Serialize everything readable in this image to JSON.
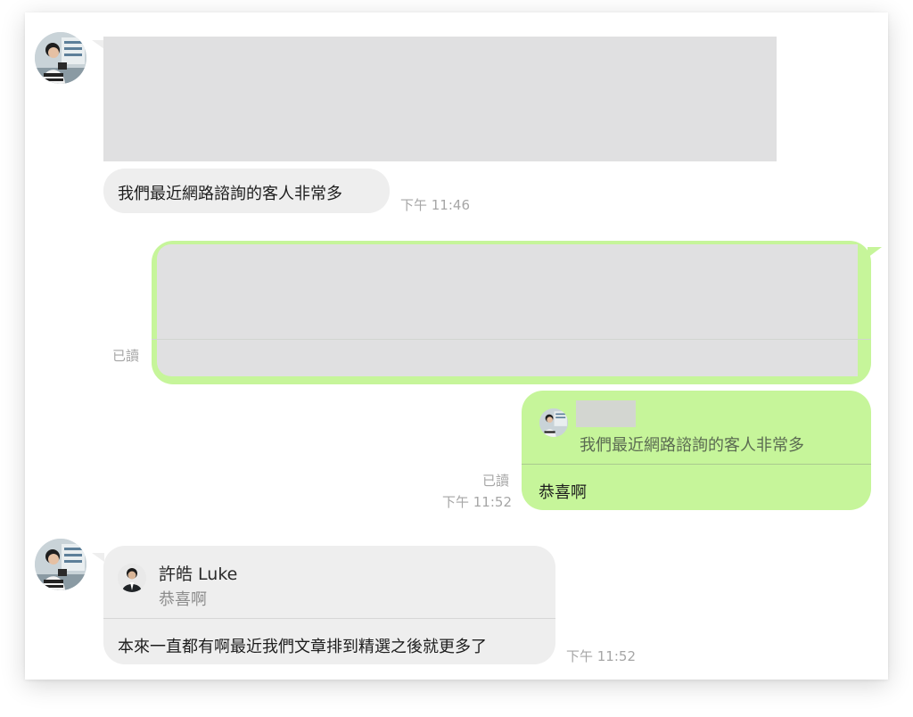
{
  "conversation": {
    "msg1": {
      "text": "我們最近網路諮詢的客人非常多",
      "time": "下午 11:46"
    },
    "msg2": {
      "read_status": "已讀"
    },
    "msg3": {
      "quoted_text": "我們最近網路諮詢的客人非常多",
      "reply_text": "恭喜啊",
      "read_status": "已讀",
      "time": "下午 11:52"
    },
    "msg4": {
      "quoted_name": "許皓 Luke",
      "quoted_text": "恭喜啊",
      "reply_text": "本來一直都有啊最近我們文章排到精選之後就更多了",
      "time": "下午 11:52"
    }
  },
  "colors": {
    "incoming_bubble": "#eeeeee",
    "outgoing_bubble": "#c6f59a",
    "redacted_block": "#e0e0e1",
    "meta_text": "#a6a6a6"
  }
}
